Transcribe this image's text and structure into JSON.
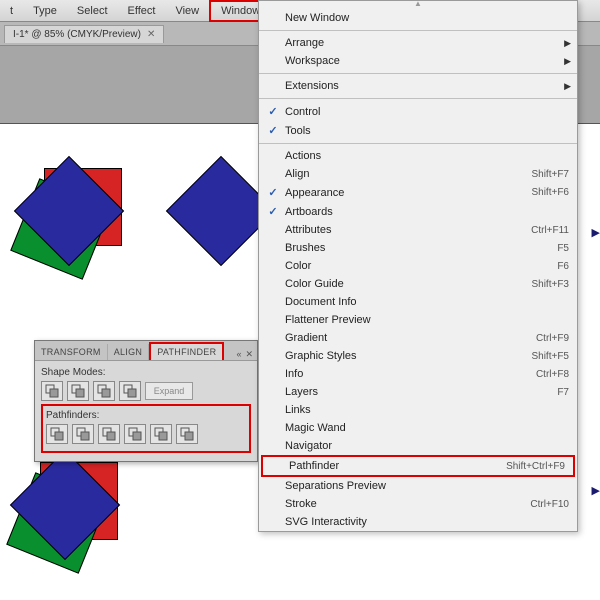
{
  "menubar": {
    "items": [
      "t",
      "Type",
      "Select",
      "Effect",
      "View",
      "Window"
    ]
  },
  "doc_tab": {
    "label": "I-1* @ 85% (CMYK/Preview)"
  },
  "dropdown": {
    "groups": [
      [
        {
          "label": "New Window"
        }
      ],
      [
        {
          "label": "Arrange",
          "submenu": true
        },
        {
          "label": "Workspace",
          "submenu": true
        }
      ],
      [
        {
          "label": "Extensions",
          "submenu": true
        }
      ],
      [
        {
          "label": "Control",
          "checked": true
        },
        {
          "label": "Tools",
          "checked": true
        }
      ],
      [
        {
          "label": "Actions"
        },
        {
          "label": "Align",
          "shortcut": "Shift+F7"
        },
        {
          "label": "Appearance",
          "shortcut": "Shift+F6",
          "checked": true
        },
        {
          "label": "Artboards",
          "checked": true
        },
        {
          "label": "Attributes",
          "shortcut": "Ctrl+F11"
        },
        {
          "label": "Brushes",
          "shortcut": "F5"
        },
        {
          "label": "Color",
          "shortcut": "F6"
        },
        {
          "label": "Color Guide",
          "shortcut": "Shift+F3"
        },
        {
          "label": "Document Info"
        },
        {
          "label": "Flattener Preview"
        },
        {
          "label": "Gradient",
          "shortcut": "Ctrl+F9"
        },
        {
          "label": "Graphic Styles",
          "shortcut": "Shift+F5"
        },
        {
          "label": "Info",
          "shortcut": "Ctrl+F8"
        },
        {
          "label": "Layers",
          "shortcut": "F7"
        },
        {
          "label": "Links"
        },
        {
          "label": "Magic Wand"
        },
        {
          "label": "Navigator"
        },
        {
          "label": "Pathfinder",
          "shortcut": "Shift+Ctrl+F9",
          "highlight": true
        },
        {
          "label": "Separations Preview"
        },
        {
          "label": "Stroke",
          "shortcut": "Ctrl+F10"
        },
        {
          "label": "SVG Interactivity"
        }
      ]
    ]
  },
  "panel": {
    "tabs": [
      "TRANSFORM",
      "ALIGN",
      "PATHFINDER"
    ],
    "active_tab": 2,
    "shape_modes_label": "Shape Modes:",
    "pathfinders_label": "Pathfinders:",
    "expand_label": "Expand",
    "shape_mode_icons": [
      "unite-icon",
      "minus-front-icon",
      "intersect-icon",
      "exclude-icon"
    ],
    "pathfinder_icons": [
      "divide-icon",
      "trim-icon",
      "merge-icon",
      "crop-icon",
      "outline-icon",
      "minus-back-icon"
    ]
  }
}
